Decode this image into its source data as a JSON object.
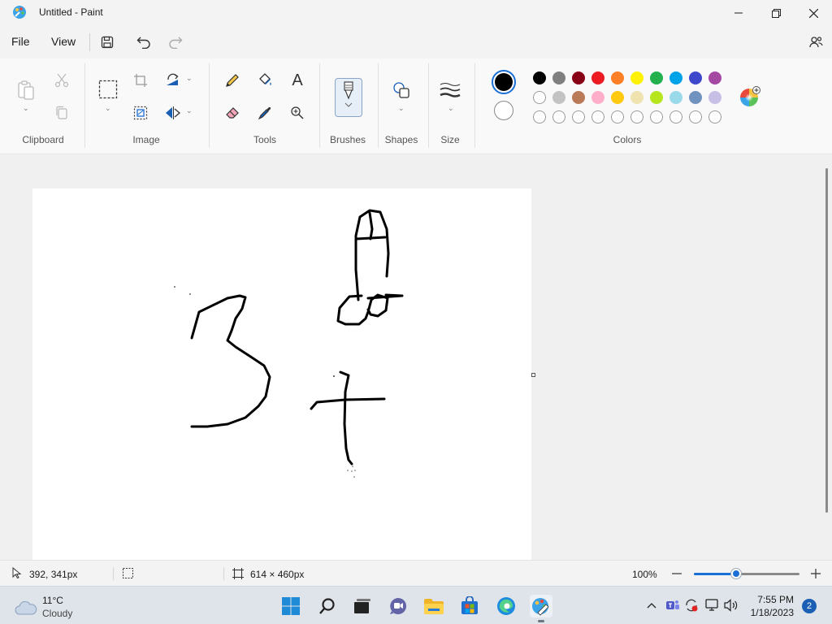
{
  "window": {
    "title": "Untitled - Paint"
  },
  "menu": {
    "file_label": "File",
    "view_label": "View"
  },
  "ribbon": {
    "groups": {
      "clipboard": "Clipboard",
      "image": "Image",
      "tools": "Tools",
      "brushes": "Brushes",
      "shapes": "Shapes",
      "size": "Size",
      "colors": "Colors"
    },
    "text_tool_glyph": "A",
    "colors": {
      "primary": "#000000",
      "secondary": "#ffffff",
      "row1": [
        "#000000",
        "#7f7f7f",
        "#880015",
        "#ed1c24",
        "#ff7f27",
        "#fff200",
        "#22b14c",
        "#00a2e8",
        "#3f48cc",
        "#a349a4"
      ],
      "row2": [
        "#ffffff",
        "#c3c3c3",
        "#b97a57",
        "#ffaec9",
        "#ffc90e",
        "#efe4b0",
        "#b5e61d",
        "#99d9ea",
        "#7092be",
        "#c8bfe7"
      ],
      "row3_empty_count": 10
    }
  },
  "status": {
    "cursor_pos": "392, 341px",
    "canvas_size": "614 × 460px",
    "zoom": "100%",
    "zoom_level": 0.4
  },
  "taskbar": {
    "weather_temp": "11°C",
    "weather_cond": "Cloudy",
    "time": "7:55 PM",
    "date": "1/18/2023",
    "notifications": "2"
  }
}
